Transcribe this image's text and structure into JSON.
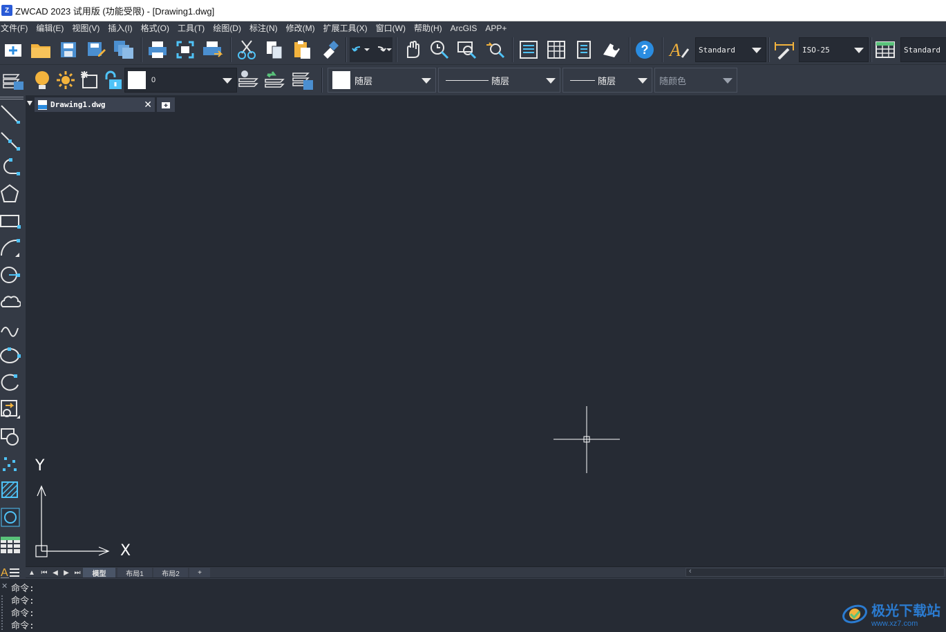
{
  "window": {
    "title": "ZWCAD 2023 试用版 (功能受限) - [Drawing1.dwg]"
  },
  "menu": [
    "文件(F)",
    "编辑(E)",
    "视图(V)",
    "插入(I)",
    "格式(O)",
    "工具(T)",
    "绘图(D)",
    "标注(N)",
    "修改(M)",
    "扩展工具(X)",
    "窗口(W)",
    "帮助(H)",
    "ArcGIS",
    "APP+"
  ],
  "toolbar": {
    "text_style": "Standard",
    "dim_style": "ISO-25",
    "table_style": "Standard"
  },
  "layer_toolbar": {
    "layer_name": "0",
    "color": "随层",
    "linetype": "随层",
    "lineweight": "随层",
    "plot_style": "随颜色"
  },
  "document": {
    "tab_label": "Drawing1.dwg"
  },
  "axes": {
    "x_label": "X",
    "y_label": "Y"
  },
  "layout_tabs": [
    "模型",
    "布局1",
    "布局2",
    "+"
  ],
  "command": {
    "lines": [
      "命令:",
      "命令:",
      "命令:",
      "命令:"
    ]
  },
  "watermark": {
    "text": "极光下载站",
    "url_text": "www.xz7.com"
  },
  "colors": {
    "accent": "#4fc3f7",
    "canvas": "#262b34",
    "toolbar": "#343a45",
    "help": "#2a8ce0"
  }
}
